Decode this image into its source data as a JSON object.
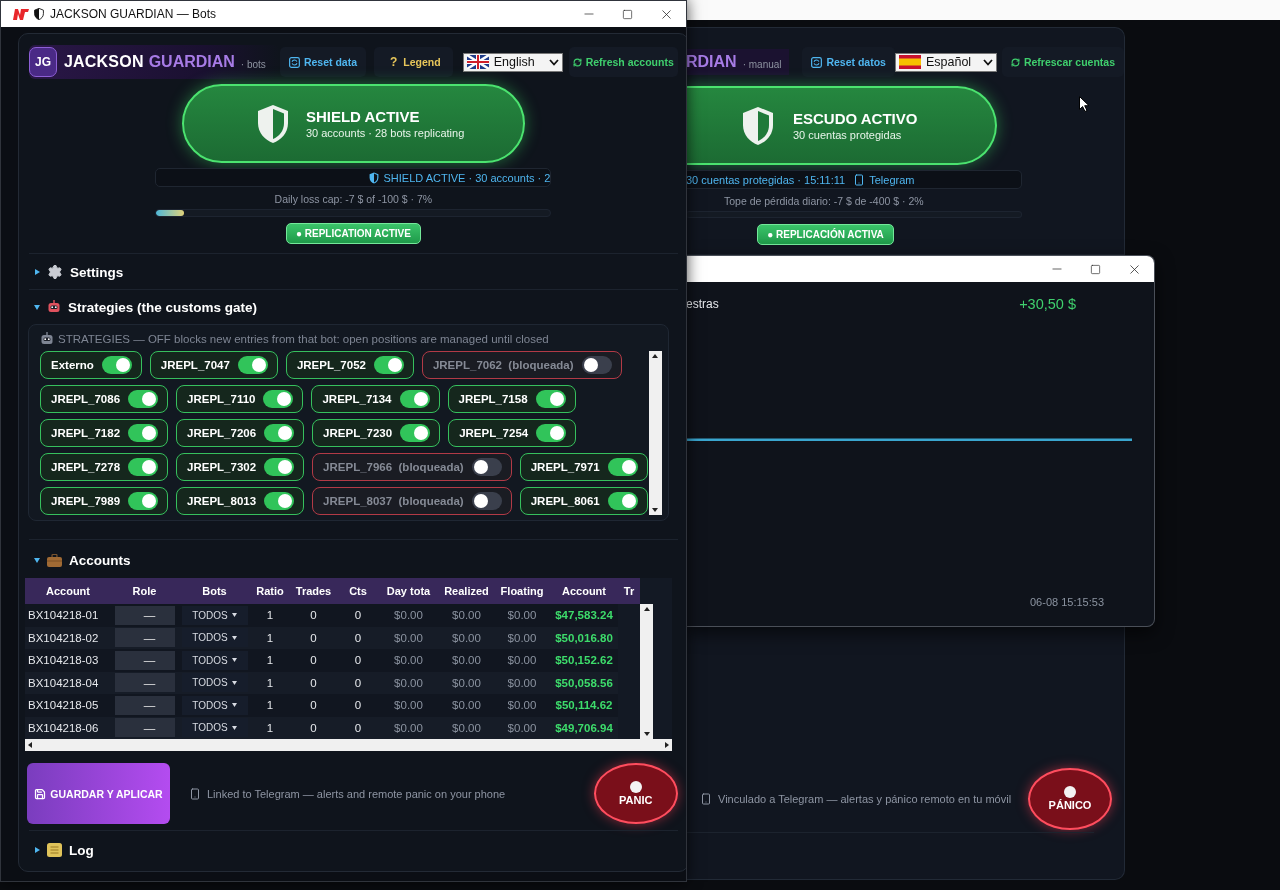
{
  "main_window": {
    "title": "JACKSON GUARDIAN — Bots",
    "header": {
      "logo": "JG",
      "brand": "JACKSON",
      "brand_accent": "GUARDIAN",
      "mode": "· bots",
      "reset": "Reset data",
      "legend_icon": "?",
      "legend": "Legend",
      "language": "English",
      "refresh": "Refresh accounts"
    },
    "shield": {
      "title": "SHIELD ACTIVE",
      "subtitle": "30 accounts · 28 bots replicating"
    },
    "ticker": "SHIELD ACTIVE · 30 accounts · 2",
    "loss_cap": {
      "label": "Daily loss cap: -7 $ of -100 $ · 7%",
      "level": 0.07
    },
    "replication": "● REPLICATION ACTIVE",
    "settings": {
      "title": "Settings",
      "expanded": false
    },
    "strategies": {
      "title": "Strategies (the customs gate)",
      "expanded": true,
      "note": "STRATEGIES — OFF blocks new entries from that bot: open positions are managed until closed",
      "chip_rows": [
        [
          {
            "name": "Externo",
            "on": true
          },
          {
            "name": "JREPL_7047",
            "on": true
          },
          {
            "name": "JREPL_7052",
            "on": true
          },
          {
            "name": "JREPL_7062",
            "note": "(bloqueada)",
            "on": false
          }
        ],
        [
          {
            "name": "JREPL_7086",
            "on": true
          },
          {
            "name": "JREPL_7110",
            "on": true
          },
          {
            "name": "JREPL_7134",
            "on": true
          },
          {
            "name": "JREPL_7158",
            "on": true
          }
        ],
        [
          {
            "name": "JREPL_7182",
            "on": true
          },
          {
            "name": "JREPL_7206",
            "on": true
          },
          {
            "name": "JREPL_7230",
            "on": true
          },
          {
            "name": "JREPL_7254",
            "on": true
          }
        ],
        [
          {
            "name": "JREPL_7278",
            "on": true
          },
          {
            "name": "JREPL_7302",
            "on": true
          },
          {
            "name": "JREPL_7966",
            "note": "(bloqueada)",
            "on": false
          },
          {
            "name": "JREPL_7971",
            "on": true
          }
        ],
        [
          {
            "name": "JREPL_7989",
            "on": true
          },
          {
            "name": "JREPL_8013",
            "on": true
          },
          {
            "name": "JREPL_8037",
            "note": "(bloqueada)",
            "on": false
          },
          {
            "name": "JREPL_8061",
            "on": true
          }
        ]
      ]
    },
    "accounts": {
      "title": "Accounts",
      "expanded": true,
      "columns": [
        "Account",
        "Role",
        "Bots",
        "Ratio",
        "Trades",
        "Cts",
        "Day tota",
        "Realized",
        "Floating",
        "Account",
        "Tr"
      ],
      "rows": [
        {
          "account": "BX104218-01",
          "role": "—",
          "bots": "TODOS",
          "ratio": "1",
          "trades": "0",
          "cts": "0",
          "day_total": "$0.00",
          "realized": "$0.00",
          "floating": "$0.00",
          "balance": "$47,583.24"
        },
        {
          "account": "BX104218-02",
          "role": "—",
          "bots": "TODOS",
          "ratio": "1",
          "trades": "0",
          "cts": "0",
          "day_total": "$0.00",
          "realized": "$0.00",
          "floating": "$0.00",
          "balance": "$50,016.80"
        },
        {
          "account": "BX104218-03",
          "role": "—",
          "bots": "TODOS",
          "ratio": "1",
          "trades": "0",
          "cts": "0",
          "day_total": "$0.00",
          "realized": "$0.00",
          "floating": "$0.00",
          "balance": "$50,152.62"
        },
        {
          "account": "BX104218-04",
          "role": "—",
          "bots": "TODOS",
          "ratio": "1",
          "trades": "0",
          "cts": "0",
          "day_total": "$0.00",
          "realized": "$0.00",
          "floating": "$0.00",
          "balance": "$50,058.56"
        },
        {
          "account": "BX104218-05",
          "role": "—",
          "bots": "TODOS",
          "ratio": "1",
          "trades": "0",
          "cts": "0",
          "day_total": "$0.00",
          "realized": "$0.00",
          "floating": "$0.00",
          "balance": "$50,114.62"
        },
        {
          "account": "BX104218-06",
          "role": "—",
          "bots": "TODOS",
          "ratio": "1",
          "trades": "0",
          "cts": "0",
          "day_total": "$0.00",
          "realized": "$0.00",
          "floating": "$0.00",
          "balance": "$49,706.94"
        }
      ]
    },
    "save": "GUARDAR Y APLICAR",
    "telegram_note": "Linked to Telegram — alerts and remote panic on your phone",
    "panic": "PANIC",
    "log": {
      "title": "Log",
      "expanded": false
    }
  },
  "back_window": {
    "brand_accent": "RDIAN",
    "mode": "· manual",
    "reset": "Reset datos",
    "language": "Español",
    "refresh": "Refrescar cuentas",
    "shield": {
      "title": "ESCUDO ACTIVO",
      "subtitle": "30 cuentas protegidas"
    },
    "ticker": "30 cuentas protegidas · 15:11:11",
    "ticker_link": "Telegram",
    "loss_cap": "Tope de pérdida diario: -7 $ de -400 $ · 2%",
    "replication": "● REPLICACIÓN ACTIVA",
    "telegram_note": "Vinculado a Telegram — alertas y pánico remoto en tu móvil",
    "panic": "PÁNICO"
  },
  "popup_window": {
    "label": "estras",
    "profit": "+30,50 $",
    "timestamp": "06-08 15:15:53"
  }
}
